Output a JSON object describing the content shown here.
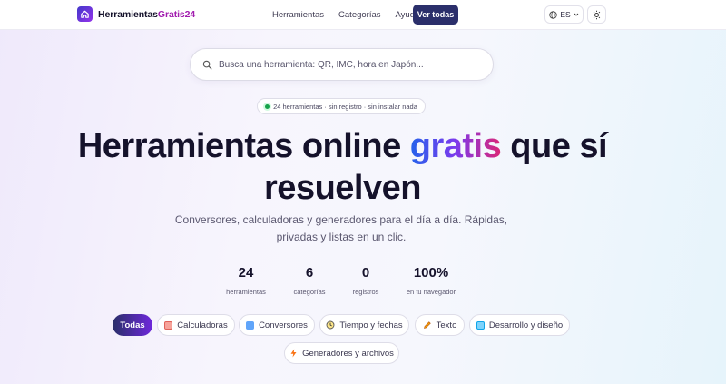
{
  "header": {
    "logo_text_main": "Herramientas",
    "logo_text_accent": "Gratis24",
    "nav": [
      "Herramientas",
      "Categorías",
      "Ayuda"
    ],
    "cta_label": "Ver todas",
    "language": "ES"
  },
  "search": {
    "placeholder": "Busca una herramienta: QR, IMC, hora en Japón..."
  },
  "badge": {
    "text": "24 herramientas · sin registro · sin instalar nada"
  },
  "hero": {
    "title_before": "Herramientas online ",
    "title_highlight": "gratis",
    "title_after": " que sí resuelven",
    "subtitle": "Conversores, calculadoras y generadores para el día a día. Rápidas, privadas y listas en un clic."
  },
  "stats": [
    {
      "value": "24",
      "label": "herramientas"
    },
    {
      "value": "6",
      "label": "categorías"
    },
    {
      "value": "0",
      "label": "registros"
    },
    {
      "value": "100%",
      "label": "en tu navegador"
    }
  ],
  "categories": [
    {
      "label": "Todas",
      "icon": "none",
      "active": true
    },
    {
      "label": "Calculadoras",
      "icon": "calculator-icon",
      "color": "#e0625a"
    },
    {
      "label": "Conversores",
      "icon": "convert-icon",
      "color": "#3b82f6"
    },
    {
      "label": "Tiempo y fechas",
      "icon": "clock-icon",
      "color": "#6b6b6b"
    },
    {
      "label": "Texto",
      "icon": "pencil-icon",
      "color": "#f59e0b"
    },
    {
      "label": "Desarrollo y diseño",
      "icon": "book-icon",
      "color": "#38bdf8"
    },
    {
      "label": "Generadores y archivos",
      "icon": "lightning-icon",
      "color": "#f97316"
    }
  ]
}
